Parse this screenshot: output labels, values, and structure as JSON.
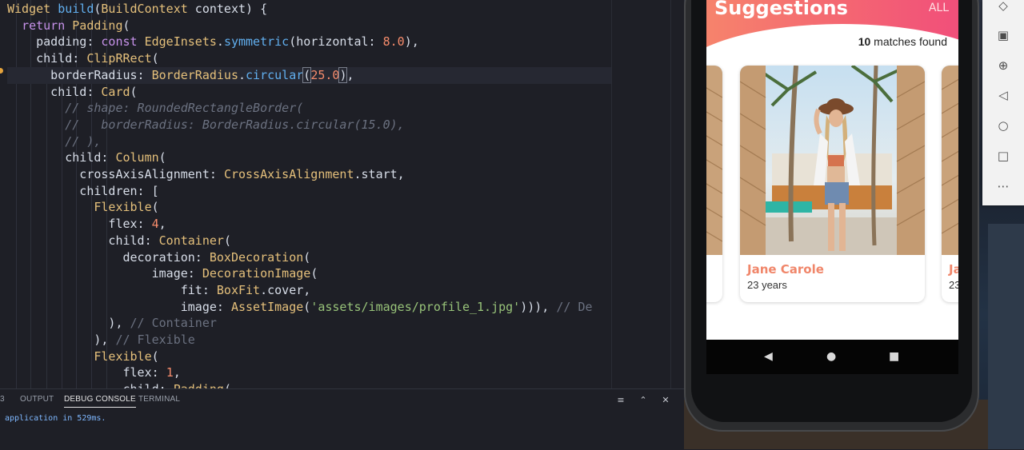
{
  "editor": {
    "lines": [
      [
        {
          "t": "Widget ",
          "c": "tok-cls"
        },
        {
          "t": "build",
          "c": "tok-fn"
        },
        {
          "t": "(",
          "c": "tok-punc"
        },
        {
          "t": "BuildContext",
          "c": "tok-cls"
        },
        {
          "t": " context) {",
          "c": "tok-punc"
        }
      ],
      [
        {
          "t": "  ",
          "c": ""
        },
        {
          "t": "return ",
          "c": "tok-kw"
        },
        {
          "t": "Padding",
          "c": "tok-cls"
        },
        {
          "t": "(",
          "c": "tok-punc"
        }
      ],
      [
        {
          "t": "    padding: ",
          "c": "tok-punc"
        },
        {
          "t": "const ",
          "c": "tok-kw"
        },
        {
          "t": "EdgeInsets",
          "c": "tok-cls"
        },
        {
          "t": ".",
          "c": "tok-punc"
        },
        {
          "t": "symmetric",
          "c": "tok-fn"
        },
        {
          "t": "(horizontal: ",
          "c": "tok-punc"
        },
        {
          "t": "8.0",
          "c": "tok-num"
        },
        {
          "t": "),",
          "c": "tok-punc"
        }
      ],
      [
        {
          "t": "    child: ",
          "c": "tok-punc"
        },
        {
          "t": "ClipRRect",
          "c": "tok-cls"
        },
        {
          "t": "(",
          "c": "tok-punc"
        }
      ],
      [
        {
          "t": "      borderRadius: ",
          "c": "tok-punc"
        },
        {
          "t": "BorderRadius",
          "c": "tok-cls"
        },
        {
          "t": ".",
          "c": "tok-punc"
        },
        {
          "t": "circular",
          "c": "tok-fn"
        },
        {
          "t": "(",
          "c": "tok-punc cursor-box"
        },
        {
          "t": "25",
          "c": "tok-num"
        },
        {
          "t": ".0",
          "c": "tok-num"
        },
        {
          "t": ")",
          "c": "tok-punc cursor-box"
        },
        {
          "t": ",",
          "c": "tok-punc"
        }
      ],
      [
        {
          "t": "      child: ",
          "c": "tok-punc"
        },
        {
          "t": "Card",
          "c": "tok-cls"
        },
        {
          "t": "(",
          "c": "tok-punc"
        }
      ],
      [
        {
          "t": "        // shape: RoundedRectangleBorder(",
          "c": "tok-cm"
        }
      ],
      [
        {
          "t": "        //   borderRadius: BorderRadius.circular(15.0),",
          "c": "tok-cm"
        }
      ],
      [
        {
          "t": "        // ),",
          "c": "tok-cm"
        }
      ],
      [
        {
          "t": "        child: ",
          "c": "tok-punc"
        },
        {
          "t": "Column",
          "c": "tok-cls"
        },
        {
          "t": "(",
          "c": "tok-punc"
        }
      ],
      [
        {
          "t": "          crossAxisAlignment: ",
          "c": "tok-punc"
        },
        {
          "t": "CrossAxisAlignment",
          "c": "tok-cls"
        },
        {
          "t": ".start,",
          "c": "tok-punc"
        }
      ],
      [
        {
          "t": "          children: [",
          "c": "tok-punc"
        }
      ],
      [
        {
          "t": "            ",
          "c": ""
        },
        {
          "t": "Flexible",
          "c": "tok-cls"
        },
        {
          "t": "(",
          "c": "tok-punc"
        }
      ],
      [
        {
          "t": "              flex: ",
          "c": "tok-punc"
        },
        {
          "t": "4",
          "c": "tok-num"
        },
        {
          "t": ",",
          "c": "tok-punc"
        }
      ],
      [
        {
          "t": "              child: ",
          "c": "tok-punc"
        },
        {
          "t": "Container",
          "c": "tok-cls"
        },
        {
          "t": "(",
          "c": "tok-punc"
        }
      ],
      [
        {
          "t": "                decoration: ",
          "c": "tok-punc"
        },
        {
          "t": "BoxDecoration",
          "c": "tok-cls"
        },
        {
          "t": "(",
          "c": "tok-punc"
        }
      ],
      [
        {
          "t": "                    image: ",
          "c": "tok-punc"
        },
        {
          "t": "DecorationImage",
          "c": "tok-cls"
        },
        {
          "t": "(",
          "c": "tok-punc"
        }
      ],
      [
        {
          "t": "                        fit: ",
          "c": "tok-punc"
        },
        {
          "t": "BoxFit",
          "c": "tok-cls"
        },
        {
          "t": ".cover,",
          "c": "tok-punc"
        }
      ],
      [
        {
          "t": "                        image: ",
          "c": "tok-punc"
        },
        {
          "t": "AssetImage",
          "c": "tok-cls"
        },
        {
          "t": "(",
          "c": "tok-punc"
        },
        {
          "t": "'assets/images/profile_1.jpg'",
          "c": "tok-str"
        },
        {
          "t": "))), ",
          "c": "tok-punc"
        },
        {
          "t": "// De",
          "c": "tok-cm2"
        }
      ],
      [
        {
          "t": "              ), ",
          "c": "tok-punc"
        },
        {
          "t": "// Container",
          "c": "tok-cm2"
        }
      ],
      [
        {
          "t": "            ), ",
          "c": "tok-punc"
        },
        {
          "t": "// Flexible",
          "c": "tok-cm2"
        }
      ],
      [
        {
          "t": "            ",
          "c": ""
        },
        {
          "t": "Flexible",
          "c": "tok-cls"
        },
        {
          "t": "(",
          "c": "tok-punc"
        }
      ],
      [
        {
          "t": "                flex: ",
          "c": "tok-punc"
        },
        {
          "t": "1",
          "c": "tok-num"
        },
        {
          "t": ",",
          "c": "tok-punc"
        }
      ],
      [
        {
          "t": "                child: ",
          "c": "tok-punc"
        },
        {
          "t": "Padding",
          "c": "tok-cls"
        },
        {
          "t": "(",
          "c": "tok-punc"
        }
      ]
    ]
  },
  "panel": {
    "tab_partial": "3",
    "tabs": [
      "OUTPUT",
      "DEBUG CONSOLE",
      "TERMINAL"
    ],
    "console_text": "application in 529ms."
  },
  "app": {
    "title": "Suggestions",
    "all_label": "ALL",
    "matches_count": "10",
    "matches_suffix": " matches found",
    "card_main": {
      "name": "Jane Carole",
      "age": "23 years"
    },
    "card_right_partial": {
      "name": "Ja",
      "age": "23"
    }
  },
  "toolbar_icons": [
    "tag-icon",
    "camera-icon",
    "zoom-in-icon",
    "back-icon",
    "home-icon",
    "overview-icon",
    "more-icon"
  ],
  "nav_icons": [
    "back-triangle-icon",
    "home-circle-icon",
    "recents-square-icon"
  ]
}
